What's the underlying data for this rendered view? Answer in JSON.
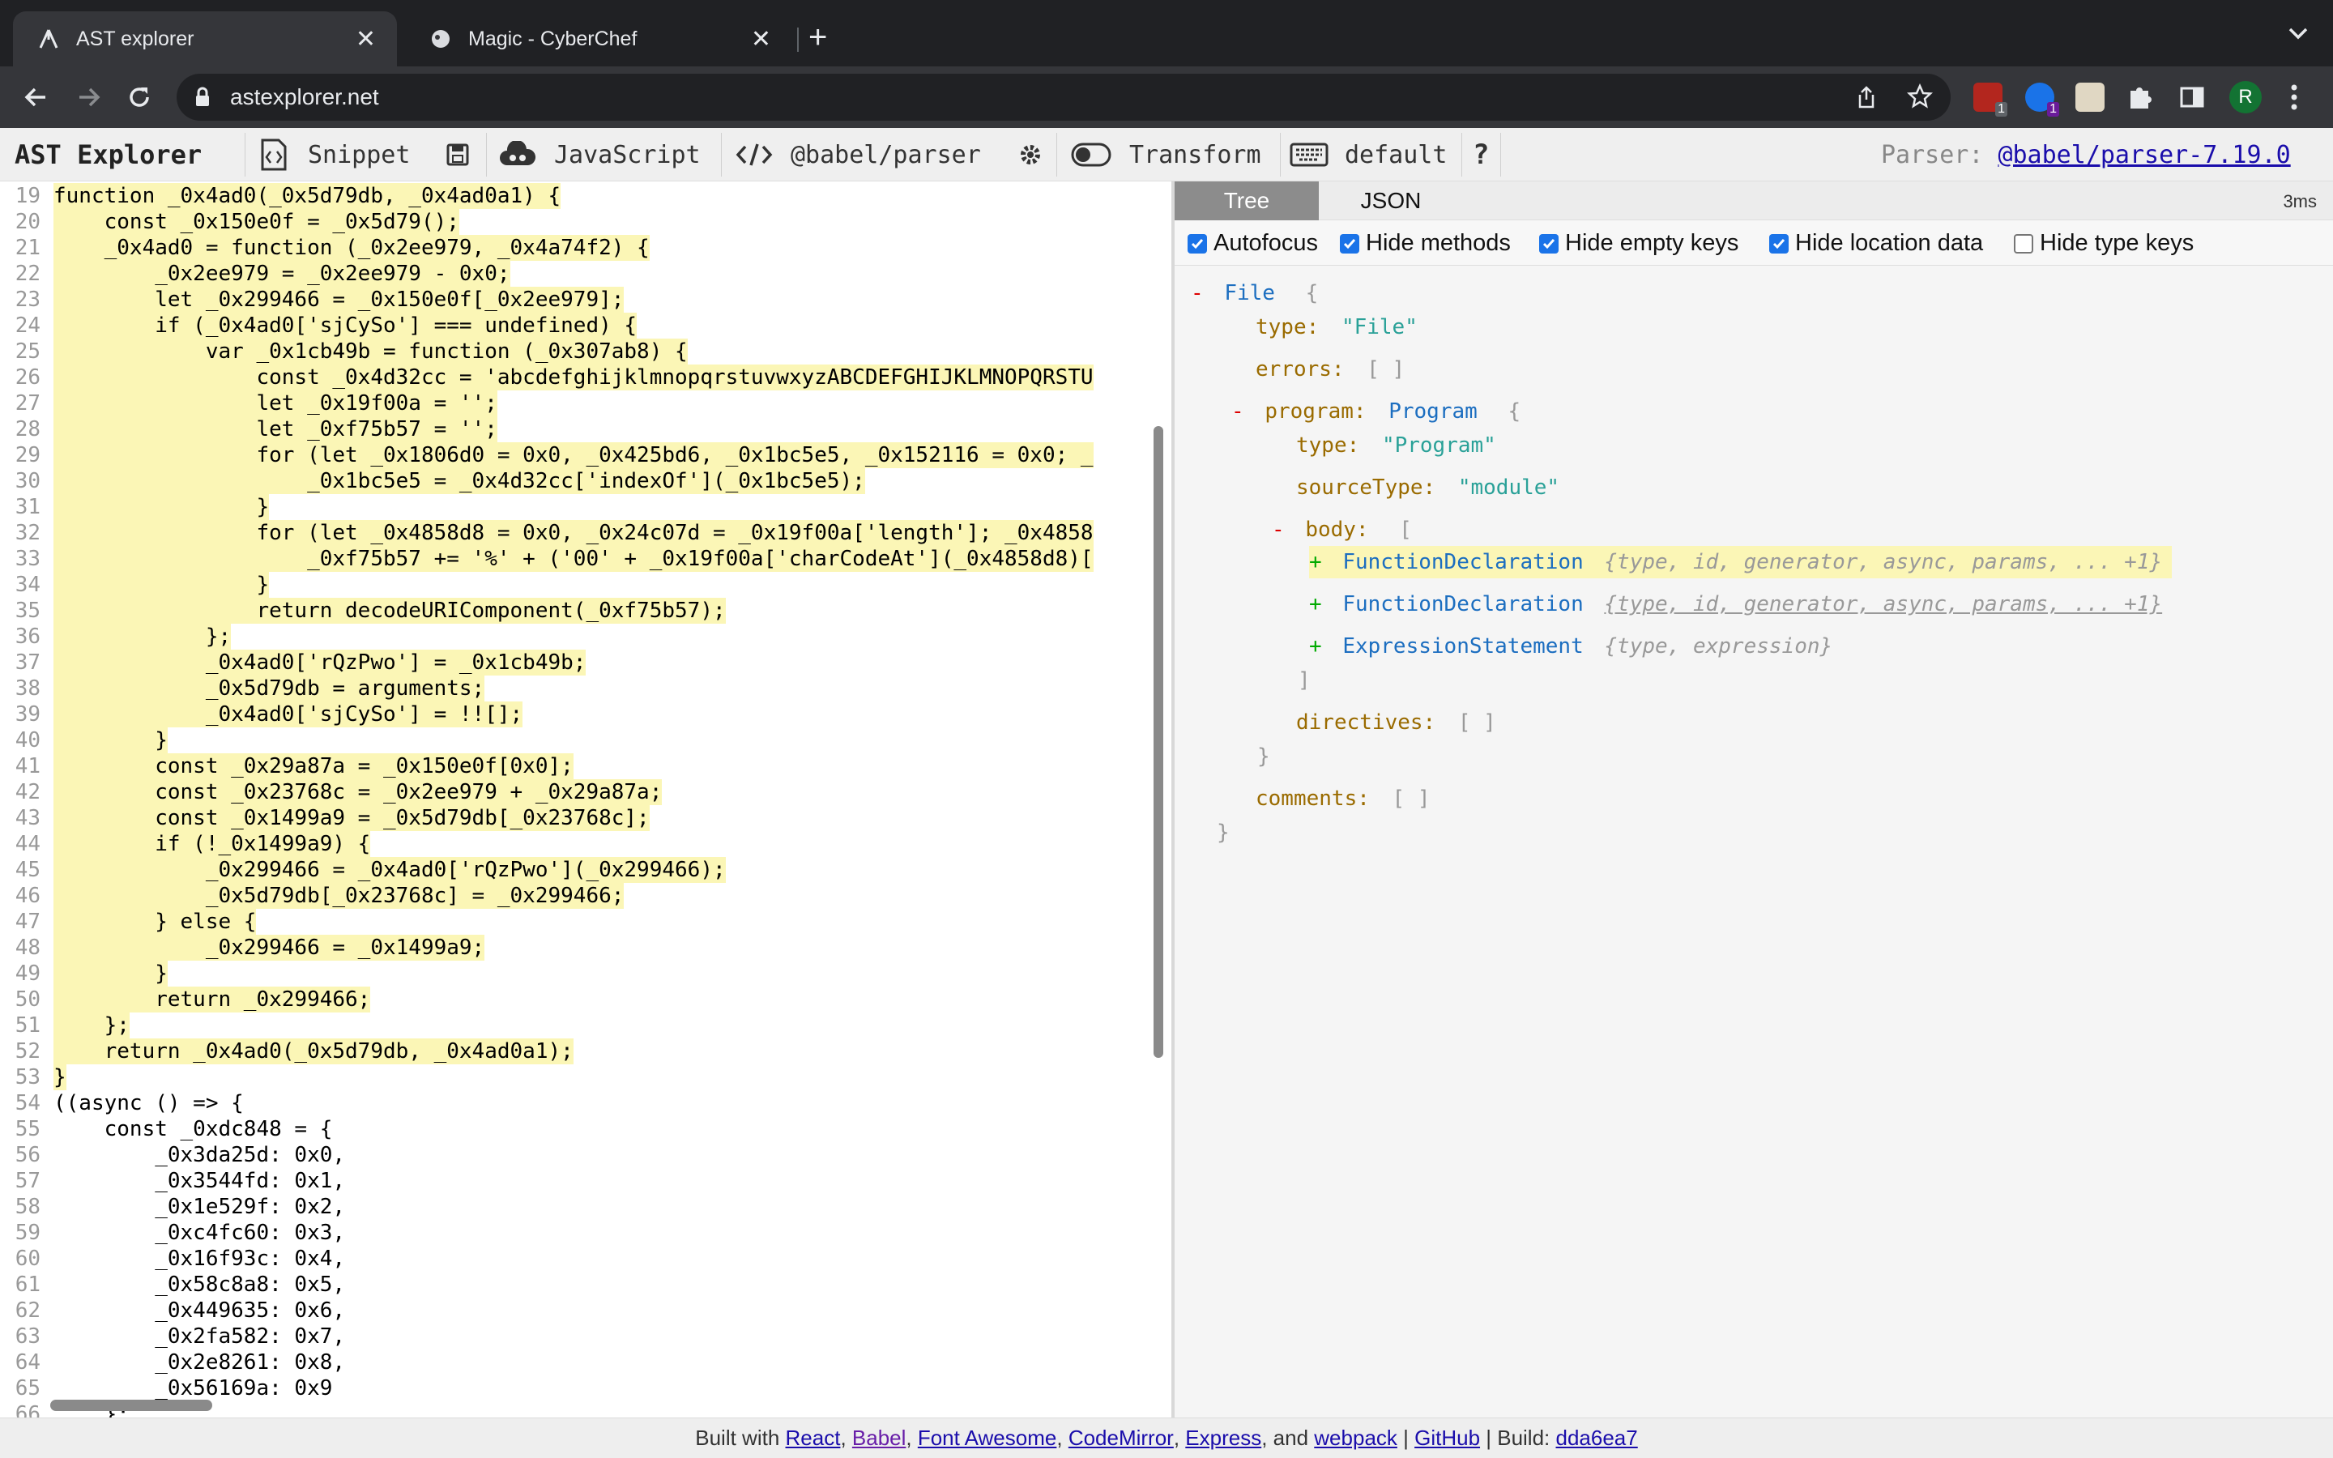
{
  "browser": {
    "tabs": [
      {
        "title": "AST explorer",
        "icon": "astexplorer-favicon",
        "active": true
      },
      {
        "title": "Magic - CyberChef",
        "icon": "cyberchef-favicon",
        "active": false
      }
    ],
    "url": "astexplorer.net",
    "extension_badges": [
      "1",
      "1"
    ],
    "profile_initial": "R"
  },
  "appbar": {
    "title": "AST Explorer",
    "snippet": "Snippet",
    "language": "JavaScript",
    "parser": "@babel/parser",
    "transform": "Transform",
    "keymap": "default",
    "help": "?",
    "parser_label": "Parser:",
    "parser_version": "@babel/parser-7.19.0"
  },
  "editor": {
    "lines": [
      {
        "n": "19",
        "code": "function _0x4ad0(_0x5d79db, _0x4ad0a1) {",
        "hl": true
      },
      {
        "n": "20",
        "code": "    const _0x150e0f = _0x5d79();",
        "hl": true
      },
      {
        "n": "21",
        "code": "    _0x4ad0 = function (_0x2ee979, _0x4a74f2) {",
        "hl": true
      },
      {
        "n": "22",
        "code": "        _0x2ee979 = _0x2ee979 - 0x0;",
        "hl": true
      },
      {
        "n": "23",
        "code": "        let _0x299466 = _0x150e0f[_0x2ee979];",
        "hl": true
      },
      {
        "n": "24",
        "code": "        if (_0x4ad0['sjCySo'] === undefined) {",
        "hl": true
      },
      {
        "n": "25",
        "code": "            var _0x1cb49b = function (_0x307ab8) {",
        "hl": true
      },
      {
        "n": "26",
        "code": "                const _0x4d32cc = 'abcdefghijklmnopqrstuvwxyzABCDEFGHIJKLMNOPQRSTU",
        "hl": true
      },
      {
        "n": "27",
        "code": "                let _0x19f00a = '';",
        "hl": true
      },
      {
        "n": "28",
        "code": "                let _0xf75b57 = '';",
        "hl": true
      },
      {
        "n": "29",
        "code": "                for (let _0x1806d0 = 0x0, _0x425bd6, _0x1bc5e5, _0x152116 = 0x0; _",
        "hl": true
      },
      {
        "n": "30",
        "code": "                    _0x1bc5e5 = _0x4d32cc['indexOf'](_0x1bc5e5);",
        "hl": true
      },
      {
        "n": "31",
        "code": "                }",
        "hl": true
      },
      {
        "n": "32",
        "code": "                for (let _0x4858d8 = 0x0, _0x24c07d = _0x19f00a['length']; _0x4858",
        "hl": true
      },
      {
        "n": "33",
        "code": "                    _0xf75b57 += '%' + ('00' + _0x19f00a['charCodeAt'](_0x4858d8)[",
        "hl": true
      },
      {
        "n": "34",
        "code": "                }",
        "hl": true
      },
      {
        "n": "35",
        "code": "                return decodeURIComponent(_0xf75b57);",
        "hl": true
      },
      {
        "n": "36",
        "code": "            };",
        "hl": true
      },
      {
        "n": "37",
        "code": "            _0x4ad0['rQzPwo'] = _0x1cb49b;",
        "hl": true
      },
      {
        "n": "38",
        "code": "            _0x5d79db = arguments;",
        "hl": true
      },
      {
        "n": "39",
        "code": "            _0x4ad0['sjCySo'] = !![];",
        "hl": true
      },
      {
        "n": "40",
        "code": "        }",
        "hl": true
      },
      {
        "n": "41",
        "code": "        const _0x29a87a = _0x150e0f[0x0];",
        "hl": true
      },
      {
        "n": "42",
        "code": "        const _0x23768c = _0x2ee979 + _0x29a87a;",
        "hl": true
      },
      {
        "n": "43",
        "code": "        const _0x1499a9 = _0x5d79db[_0x23768c];",
        "hl": true
      },
      {
        "n": "44",
        "code": "        if (!_0x1499a9) {",
        "hl": true
      },
      {
        "n": "45",
        "code": "            _0x299466 = _0x4ad0['rQzPwo'](_0x299466);",
        "hl": true
      },
      {
        "n": "46",
        "code": "            _0x5d79db[_0x23768c] = _0x299466;",
        "hl": true
      },
      {
        "n": "47",
        "code": "        } else {",
        "hl": true
      },
      {
        "n": "48",
        "code": "            _0x299466 = _0x1499a9;",
        "hl": true
      },
      {
        "n": "49",
        "code": "        }",
        "hl": true
      },
      {
        "n": "50",
        "code": "        return _0x299466;",
        "hl": true
      },
      {
        "n": "51",
        "code": "    };",
        "hl": true
      },
      {
        "n": "52",
        "code": "    return _0x4ad0(_0x5d79db, _0x4ad0a1);",
        "hl": true
      },
      {
        "n": "53",
        "code": "}",
        "hl": true
      },
      {
        "n": "54",
        "code": "((async () => {",
        "hl": false
      },
      {
        "n": "55",
        "code": "    const _0xdc848 = {",
        "hl": false
      },
      {
        "n": "56",
        "code": "        _0x3da25d: 0x0,",
        "hl": false
      },
      {
        "n": "57",
        "code": "        _0x3544fd: 0x1,",
        "hl": false
      },
      {
        "n": "58",
        "code": "        _0x1e529f: 0x2,",
        "hl": false
      },
      {
        "n": "59",
        "code": "        _0xc4fc60: 0x3,",
        "hl": false
      },
      {
        "n": "60",
        "code": "        _0x16f93c: 0x4,",
        "hl": false
      },
      {
        "n": "61",
        "code": "        _0x58c8a8: 0x5,",
        "hl": false
      },
      {
        "n": "62",
        "code": "        _0x449635: 0x6,",
        "hl": false
      },
      {
        "n": "63",
        "code": "        _0x2fa582: 0x7,",
        "hl": false
      },
      {
        "n": "64",
        "code": "        _0x2e8261: 0x8,",
        "hl": false
      },
      {
        "n": "65",
        "code": "        _0x56169a: 0x9",
        "hl": false
      },
      {
        "n": "66",
        "code": "    };",
        "hl": false
      }
    ]
  },
  "output": {
    "tabs": [
      "Tree",
      "JSON"
    ],
    "active_tab": "Tree",
    "timing": "3ms",
    "options": [
      {
        "label": "Autofocus",
        "checked": true
      },
      {
        "label": "Hide methods",
        "checked": true
      },
      {
        "label": "Hide empty keys",
        "checked": true
      },
      {
        "label": "Hide location data",
        "checked": true
      },
      {
        "label": "Hide type keys",
        "checked": false
      }
    ],
    "tree": {
      "root_name": "File",
      "root_type_key": "type:",
      "root_type_value": "\"File\"",
      "errors_key": "errors:",
      "program_key": "program:",
      "program_name": "Program",
      "program_type_value": "\"Program\"",
      "sourcetype_key": "sourceType:",
      "sourcetype_value": "\"module\"",
      "body_key": "body:",
      "body_items": [
        {
          "name": "FunctionDeclaration",
          "summary": "{type, id, generator, async, params, ... +1}"
        },
        {
          "name": "FunctionDeclaration",
          "summary": "{type, id, generator, async, params, ... +1}"
        },
        {
          "name": "ExpressionStatement",
          "summary": "{type, expression}"
        }
      ],
      "directives_key": "directives:",
      "comments_key": "comments:",
      "empty_array": "[ ]",
      "open_brace": "{",
      "close_brace": "}",
      "open_bracket": "[",
      "close_bracket": "]",
      "minus": "-",
      "plus": "+"
    }
  },
  "footer": {
    "prefix": "Built with ",
    "links": [
      "React",
      "Babel",
      "Font Awesome",
      "CodeMirror",
      "Express",
      "webpack"
    ],
    "and": ", and ",
    "github": "GitHub",
    "build_label": " | Build: ",
    "build_hash": "dda6ea7"
  },
  "colors": {
    "highlight": "#fbf6b6",
    "link": "#1a0dab",
    "tree_name": "#1c6ec0",
    "tree_key": "#9a6b00"
  }
}
